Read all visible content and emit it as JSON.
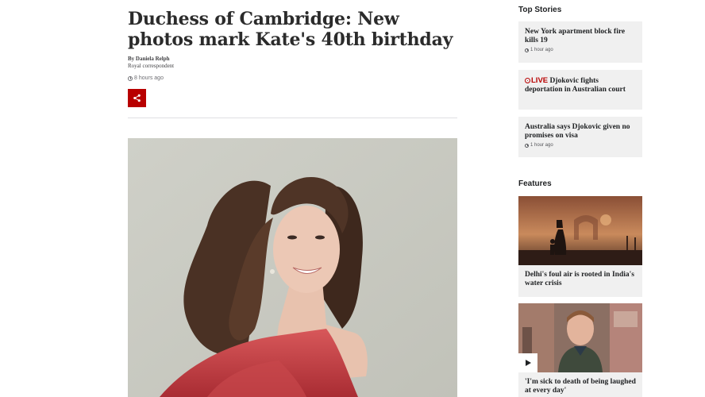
{
  "article": {
    "headline": "Duchess of Cambridge: New photos mark Kate's 40th birthday",
    "byline": "By Daniela Relph",
    "role": "Royal correspondent",
    "time": "8 hours ago",
    "share_icon": "share-icon",
    "hero_image": "photo-woman-red-dress"
  },
  "sidebar": {
    "top_stories_heading": "Top Stories",
    "stories": [
      {
        "title": "New York apartment block fire kills 19",
        "time": "1 hour ago"
      },
      {
        "live_badge": "LIVE",
        "title": "Djokovic fights deportation in Australian court"
      },
      {
        "title": "Australia says Djokovic given no promises on visa",
        "time": "1 hour ago"
      }
    ],
    "features_heading": "Features",
    "features": [
      {
        "title": "Delhi's foul air is rooted in India's water crisis",
        "image": "smog-india-gate"
      },
      {
        "title": "'I'm sick to death of being laughed at every day'",
        "image": "man-street-video",
        "icon": "play-icon"
      }
    ]
  },
  "colors": {
    "brand_red": "#b80000",
    "card_bg": "#f0f0f0",
    "text": "#202224"
  }
}
